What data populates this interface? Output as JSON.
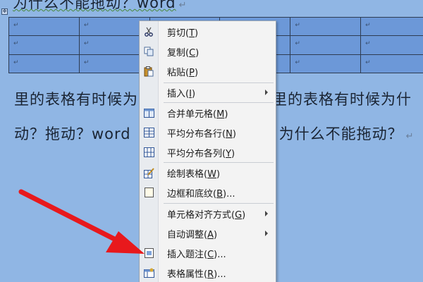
{
  "document": {
    "title": "为什么不能拖动？word",
    "paragraph_mark": "↵",
    "table": {
      "rows": 3,
      "cell_mark": "↵",
      "cells": [
        [
          "↵",
          "↵",
          "↵",
          "↵",
          "↵",
          "↵"
        ],
        [
          "↵",
          "↵",
          "↵",
          "↵",
          "↵",
          "↵"
        ],
        [
          "↵",
          "↵",
          "↵",
          "↵",
          "↵",
          "↵"
        ]
      ]
    },
    "body_line1_left": "里的表格有时候为",
    "body_line1_right": "里的表格有时候为什",
    "body_line2_left": "动？拖动？word",
    "body_line2_right": "为什么不能拖动？"
  },
  "context_menu": {
    "items": [
      {
        "label": "剪切",
        "key": "T",
        "icon": "scissors-icon"
      },
      {
        "label": "复制",
        "key": "C",
        "icon": "copy-icon"
      },
      {
        "label": "粘贴",
        "key": "P",
        "icon": "paste-icon"
      },
      {
        "label": "插入",
        "key": "I",
        "icon": "",
        "submenu": true
      },
      {
        "label": "合并单元格",
        "key": "M",
        "icon": "merge-cells-icon"
      },
      {
        "label": "平均分布各行",
        "key": "N",
        "icon": "distribute-rows-icon"
      },
      {
        "label": "平均分布各列",
        "key": "Y",
        "icon": "distribute-columns-icon"
      },
      {
        "label": "绘制表格",
        "key": "W",
        "icon": "draw-table-icon"
      },
      {
        "label": "边框和底纹",
        "key": "B",
        "suffix": "...",
        "icon": "borders-shading-icon"
      },
      {
        "label": "单元格对齐方式",
        "key": "G",
        "icon": "",
        "submenu": true
      },
      {
        "label": "自动调整",
        "key": "A",
        "icon": "",
        "submenu": true
      },
      {
        "label": "插入题注",
        "key": "C",
        "suffix": "...",
        "icon": "insert-caption-icon"
      },
      {
        "label": "表格属性",
        "key": "R",
        "suffix": "...",
        "icon": "table-properties-icon"
      }
    ]
  },
  "colors": {
    "page_background": "#90b6e4",
    "table_cell": "#6c98d8",
    "menu_background": "#f3f3f3",
    "annotation_arrow": "#e8191c"
  }
}
